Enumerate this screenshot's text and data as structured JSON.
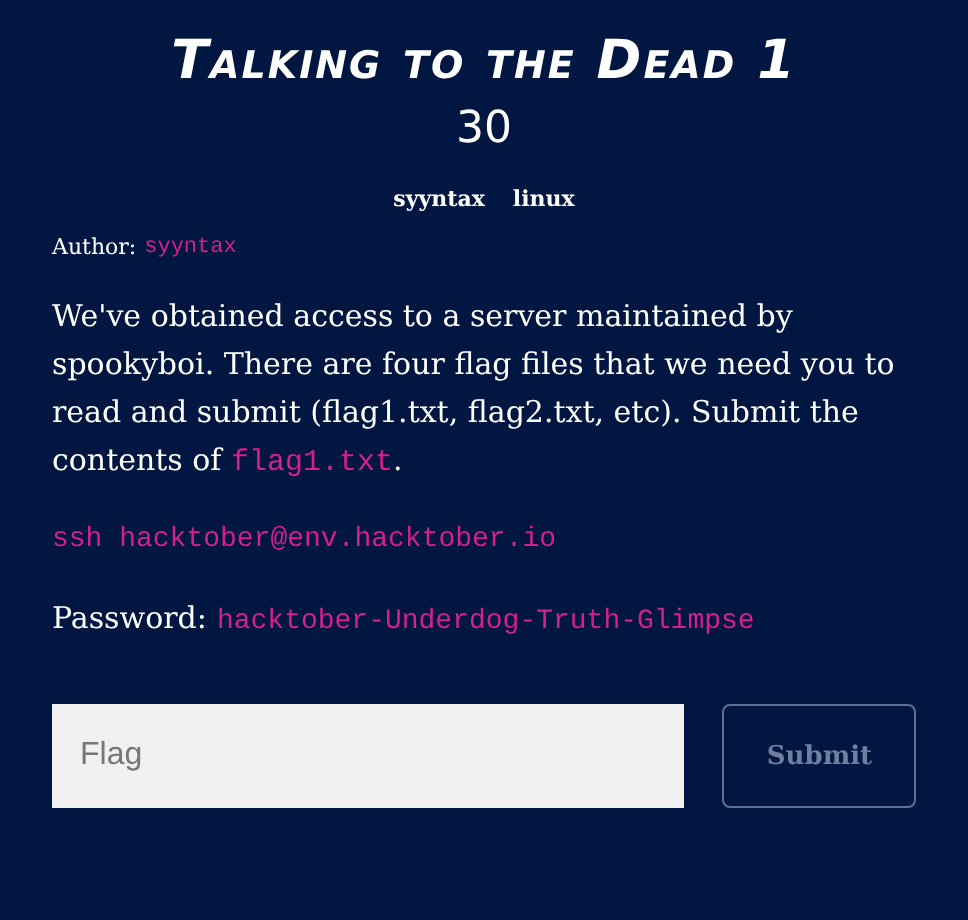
{
  "challenge": {
    "title": "Talking to the Dead 1",
    "points": "30",
    "tags": [
      "syyntax",
      "linux"
    ],
    "author": {
      "label": "Author:",
      "name": "syyntax"
    },
    "description": [
      {
        "kind": "text",
        "text": "We've obtained access to a server maintained by spookyboi. There are four flag files that we need you to read and submit (flag1.txt, flag2.txt, etc). Submit the contents of "
      },
      {
        "kind": "code",
        "text": "flag1.txt"
      },
      {
        "kind": "text",
        "text": "."
      }
    ],
    "command": "ssh hacktober@env.hacktober.io",
    "password": {
      "label": "Password:",
      "value": "hacktober-Underdog-Truth-Glimpse"
    }
  },
  "form": {
    "placeholder": "Flag",
    "submit": {
      "label": "Submit",
      "disabled": true
    }
  }
}
